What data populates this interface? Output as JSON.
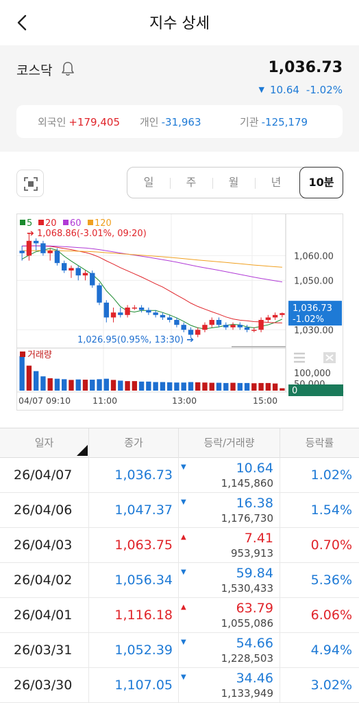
{
  "header": {
    "title": "지수 상세"
  },
  "index": {
    "name": "코스닥",
    "value": "1,036.73",
    "change": "10.64",
    "change_pct": "-1.02%",
    "direction": "down"
  },
  "investors": [
    {
      "label": "외국인",
      "value": "+179,405",
      "dir": "up"
    },
    {
      "label": "개인",
      "value": "-31,963",
      "dir": "down"
    },
    {
      "label": "기관",
      "value": "-125,179",
      "dir": "down"
    }
  ],
  "periods": [
    "일",
    "주",
    "월",
    "년",
    "10분"
  ],
  "active_period": "10분",
  "chart_data": {
    "type": "candlestick",
    "legend": [
      {
        "label": "5",
        "color": "#1a8a2e"
      },
      {
        "label": "20",
        "color": "#e0242a"
      },
      {
        "label": "60",
        "color": "#b03ad6"
      },
      {
        "label": "120",
        "color": "#f0a020"
      }
    ],
    "high_annotation": "1,068.86(-3.01%, 09:20)",
    "low_annotation": "1,026.95(0.95%, 13:30)",
    "price_ticks": [
      "1,060.00",
      "1,050.00",
      "1,030.00"
    ],
    "current_price_label": [
      "1,036.73",
      "-1.02%"
    ],
    "volume_label": "거래량",
    "volume_ticks": [
      "100,000",
      "50,000"
    ],
    "volume_zero": "0",
    "x_ticks": [
      "04/07 09:10",
      "11:00",
      "13:00",
      "15:00"
    ],
    "candles": [
      {
        "o": 1062,
        "h": 1064,
        "l": 1058,
        "c": 1061
      },
      {
        "o": 1060,
        "h": 1068.86,
        "l": 1058,
        "c": 1066
      },
      {
        "o": 1066,
        "h": 1067,
        "l": 1062,
        "c": 1065
      },
      {
        "o": 1065,
        "h": 1066,
        "l": 1060,
        "c": 1061
      },
      {
        "o": 1061,
        "h": 1063,
        "l": 1058,
        "c": 1062
      },
      {
        "o": 1062,
        "h": 1063,
        "l": 1056,
        "c": 1057
      },
      {
        "o": 1057,
        "h": 1058,
        "l": 1053,
        "c": 1054
      },
      {
        "o": 1054,
        "h": 1056,
        "l": 1051,
        "c": 1055
      },
      {
        "o": 1055,
        "h": 1056,
        "l": 1050,
        "c": 1052
      },
      {
        "o": 1052,
        "h": 1054,
        "l": 1050,
        "c": 1053
      },
      {
        "o": 1053,
        "h": 1054,
        "l": 1047,
        "c": 1048
      },
      {
        "o": 1048,
        "h": 1049,
        "l": 1040,
        "c": 1041
      },
      {
        "o": 1041,
        "h": 1042,
        "l": 1033,
        "c": 1035
      },
      {
        "o": 1035,
        "h": 1039,
        "l": 1033,
        "c": 1037
      },
      {
        "o": 1037,
        "h": 1039,
        "l": 1035,
        "c": 1036
      },
      {
        "o": 1036,
        "h": 1040,
        "l": 1035,
        "c": 1039
      },
      {
        "o": 1039,
        "h": 1040,
        "l": 1038,
        "c": 1039
      },
      {
        "o": 1039,
        "h": 1040,
        "l": 1037,
        "c": 1038
      },
      {
        "o": 1038,
        "h": 1039,
        "l": 1036,
        "c": 1037
      },
      {
        "o": 1037,
        "h": 1038,
        "l": 1035,
        "c": 1036
      },
      {
        "o": 1036,
        "h": 1037,
        "l": 1034,
        "c": 1035
      },
      {
        "o": 1035,
        "h": 1036,
        "l": 1033,
        "c": 1034
      },
      {
        "o": 1034,
        "h": 1035,
        "l": 1031,
        "c": 1032
      },
      {
        "o": 1032,
        "h": 1033,
        "l": 1029,
        "c": 1030
      },
      {
        "o": 1030,
        "h": 1031,
        "l": 1026.95,
        "c": 1028
      },
      {
        "o": 1028,
        "h": 1031,
        "l": 1027,
        "c": 1030
      },
      {
        "o": 1030,
        "h": 1033,
        "l": 1029,
        "c": 1032
      },
      {
        "o": 1032,
        "h": 1035,
        "l": 1031,
        "c": 1034
      },
      {
        "o": 1034,
        "h": 1035,
        "l": 1031,
        "c": 1032
      },
      {
        "o": 1032,
        "h": 1033,
        "l": 1030,
        "c": 1031
      },
      {
        "o": 1031,
        "h": 1033,
        "l": 1030,
        "c": 1032
      },
      {
        "o": 1032,
        "h": 1033,
        "l": 1030,
        "c": 1031
      },
      {
        "o": 1031,
        "h": 1032,
        "l": 1029,
        "c": 1030
      },
      {
        "o": 1030,
        "h": 1031,
        "l": 1029,
        "c": 1030
      },
      {
        "o": 1030,
        "h": 1035,
        "l": 1029,
        "c": 1034
      },
      {
        "o": 1034,
        "h": 1036,
        "l": 1033,
        "c": 1035
      },
      {
        "o": 1035,
        "h": 1037,
        "l": 1034,
        "c": 1036
      },
      {
        "o": 1036,
        "h": 1037,
        "l": 1035,
        "c": 1036.73
      }
    ],
    "volumes": [
      145000,
      105000,
      82000,
      60000,
      52000,
      50000,
      48000,
      45000,
      47000,
      46000,
      46000,
      48000,
      50000,
      45000,
      42000,
      40000,
      40000,
      38000,
      38000,
      36000,
      36000,
      35000,
      34000,
      34000,
      36000,
      35000,
      34000,
      33000,
      33000,
      32000,
      33000,
      32000,
      32000,
      31000,
      32000,
      32000,
      30000,
      10000
    ]
  },
  "table": {
    "headers": [
      "일자",
      "종가",
      "등락/거래량",
      "등락률"
    ],
    "rows": [
      {
        "date": "26/04/07",
        "close": "1,036.73",
        "change": "10.64",
        "volume": "1,145,860",
        "rate": "1.02%",
        "dir": "down"
      },
      {
        "date": "26/04/06",
        "close": "1,047.37",
        "change": "16.38",
        "volume": "1,176,730",
        "rate": "1.54%",
        "dir": "down"
      },
      {
        "date": "26/04/03",
        "close": "1,063.75",
        "change": "7.41",
        "volume": "953,913",
        "rate": "0.70%",
        "dir": "up"
      },
      {
        "date": "26/04/02",
        "close": "1,056.34",
        "change": "59.84",
        "volume": "1,530,433",
        "rate": "5.36%",
        "dir": "down"
      },
      {
        "date": "26/04/01",
        "close": "1,116.18",
        "change": "63.79",
        "volume": "1,055,086",
        "rate": "6.06%",
        "dir": "up"
      },
      {
        "date": "26/03/31",
        "close": "1,052.39",
        "change": "54.66",
        "volume": "1,228,503",
        "rate": "4.94%",
        "dir": "down"
      },
      {
        "date": "26/03/30",
        "close": "1,107.05",
        "change": "34.46",
        "volume": "1,133,949",
        "rate": "3.02%",
        "dir": "down"
      }
    ]
  }
}
